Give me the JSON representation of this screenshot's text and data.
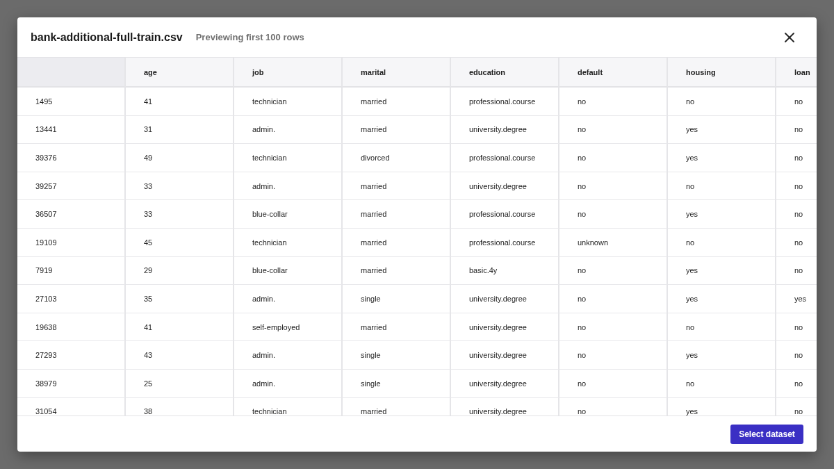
{
  "dialog": {
    "title": "bank-additional-full-train.csv",
    "subtitle": "Previewing first 100 rows"
  },
  "table": {
    "columns": [
      "age",
      "job",
      "marital",
      "education",
      "default",
      "housing",
      "loan"
    ],
    "rows": [
      {
        "index": "1495",
        "cells": [
          "41",
          "technician",
          "married",
          "professional.course",
          "no",
          "no",
          "no"
        ]
      },
      {
        "index": "13441",
        "cells": [
          "31",
          "admin.",
          "married",
          "university.degree",
          "no",
          "yes",
          "no"
        ]
      },
      {
        "index": "39376",
        "cells": [
          "49",
          "technician",
          "divorced",
          "professional.course",
          "no",
          "yes",
          "no"
        ]
      },
      {
        "index": "39257",
        "cells": [
          "33",
          "admin.",
          "married",
          "university.degree",
          "no",
          "no",
          "no"
        ]
      },
      {
        "index": "36507",
        "cells": [
          "33",
          "blue-collar",
          "married",
          "professional.course",
          "no",
          "yes",
          "no"
        ]
      },
      {
        "index": "19109",
        "cells": [
          "45",
          "technician",
          "married",
          "professional.course",
          "unknown",
          "no",
          "no"
        ]
      },
      {
        "index": "7919",
        "cells": [
          "29",
          "blue-collar",
          "married",
          "basic.4y",
          "no",
          "yes",
          "no"
        ]
      },
      {
        "index": "27103",
        "cells": [
          "35",
          "admin.",
          "single",
          "university.degree",
          "no",
          "yes",
          "yes"
        ]
      },
      {
        "index": "19638",
        "cells": [
          "41",
          "self-employed",
          "married",
          "university.degree",
          "no",
          "no",
          "no"
        ]
      },
      {
        "index": "27293",
        "cells": [
          "43",
          "admin.",
          "single",
          "university.degree",
          "no",
          "yes",
          "no"
        ]
      },
      {
        "index": "38979",
        "cells": [
          "25",
          "admin.",
          "single",
          "university.degree",
          "no",
          "no",
          "no"
        ]
      },
      {
        "index": "31054",
        "cells": [
          "38",
          "technician",
          "married",
          "university.degree",
          "no",
          "yes",
          "no"
        ]
      }
    ]
  },
  "footer": {
    "primary_button": "Select dataset"
  }
}
